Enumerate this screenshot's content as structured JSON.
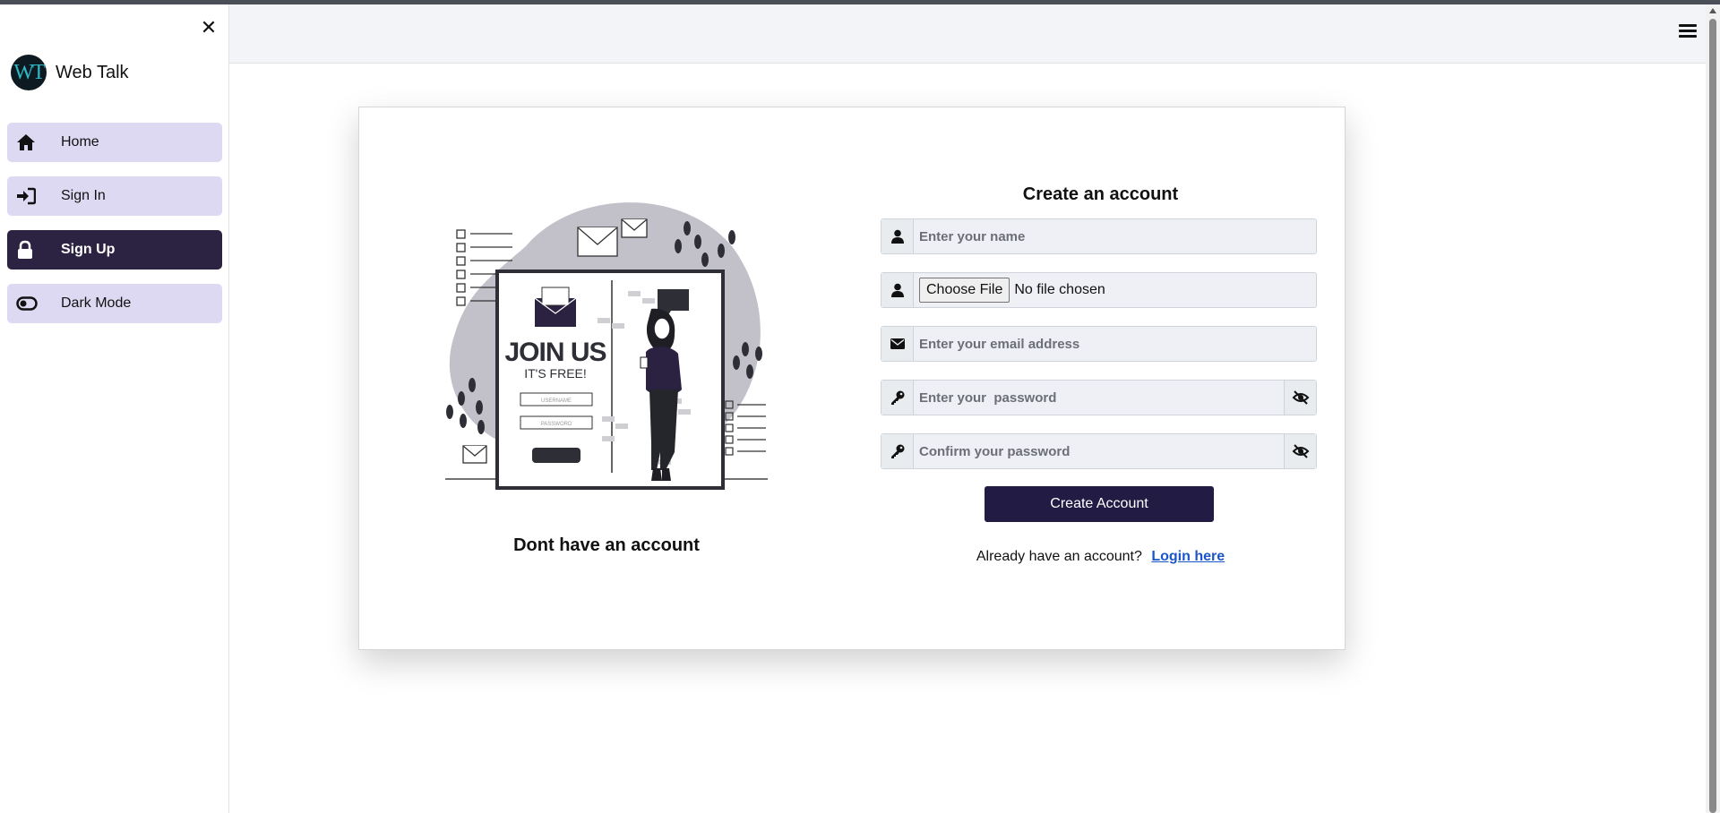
{
  "sidebar": {
    "close_glyph": "✕",
    "brand": {
      "logo_text": "WT",
      "name": "Web Talk"
    },
    "items": [
      {
        "label": "Home",
        "icon": "home-icon"
      },
      {
        "label": "Sign In",
        "icon": "sign-in-icon"
      },
      {
        "label": "Sign Up",
        "icon": "lock-icon",
        "active": true
      },
      {
        "label": "Dark Mode",
        "icon": "toggle-icon"
      }
    ]
  },
  "header": {
    "menu_icon": "hamburger-icon"
  },
  "illustration": {
    "headline": "JOIN US",
    "subline": "IT'S FREE!",
    "field1": "USERNAME",
    "field2": "PASSWORD"
  },
  "left_caption": "Dont have an account",
  "form": {
    "title": "Create an account",
    "name_placeholder": "Enter your name",
    "file_button": "Choose File",
    "file_status": "No file chosen",
    "email_placeholder": "Enter your email address",
    "password_placeholder": "Enter your  password",
    "confirm_placeholder": "Confirm your password",
    "submit": "Create Account",
    "login_prompt": "Already have an account?",
    "login_link": "Login here"
  },
  "colors": {
    "nav_bg": "#ddd9f2",
    "nav_active_bg": "#2c2342",
    "button_bg": "#221c45",
    "link": "#1b56c9"
  }
}
